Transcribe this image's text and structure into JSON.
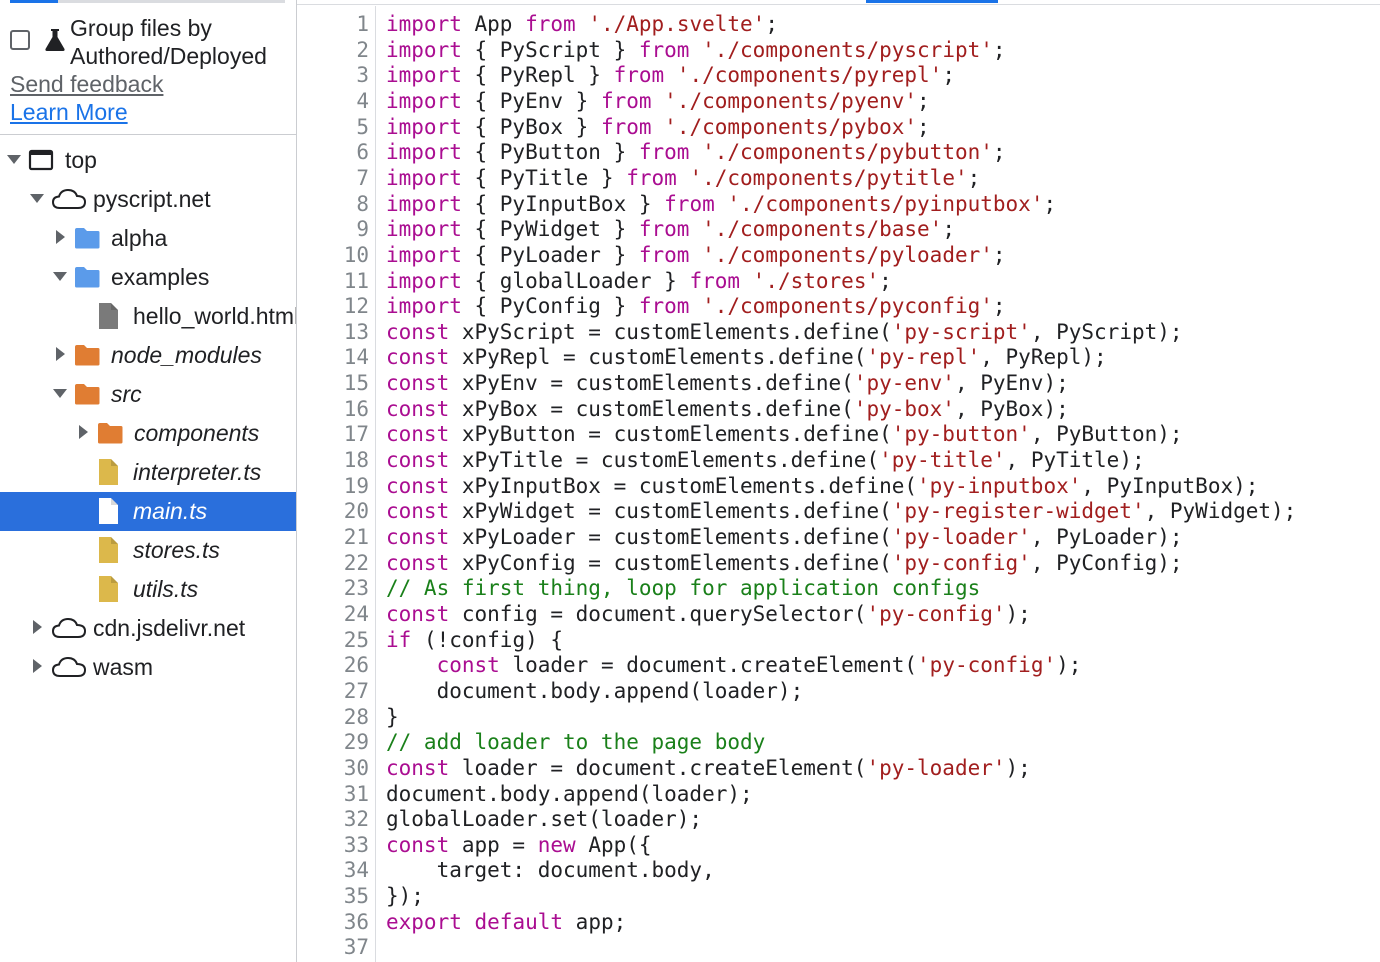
{
  "sidebar": {
    "group_label_line1": "Group files by",
    "group_label_line2": "Authored/Deployed",
    "group_checked": false,
    "feedback_link": "Send feedback",
    "learn_more_link": "Learn More",
    "tree": [
      {
        "label": "top",
        "icon": "frame-icon",
        "expanded": true,
        "italic": false
      },
      {
        "label": "pyscript.net",
        "icon": "cloud-icon",
        "expanded": true,
        "italic": false
      },
      {
        "label": "alpha",
        "icon": "folder-icon",
        "expanded": false,
        "italic": false
      },
      {
        "label": "examples",
        "icon": "folder-icon",
        "expanded": true,
        "italic": false
      },
      {
        "label": "hello_world.html",
        "icon": "file-icon",
        "italic": false
      },
      {
        "label": "node_modules",
        "icon": "folder-icon",
        "expanded": false,
        "italic": true
      },
      {
        "label": "src",
        "icon": "folder-icon",
        "expanded": true,
        "italic": true
      },
      {
        "label": "components",
        "icon": "folder-icon",
        "expanded": false,
        "italic": true
      },
      {
        "label": "interpreter.ts",
        "icon": "file-icon",
        "italic": true
      },
      {
        "label": "main.ts",
        "icon": "file-icon",
        "italic": true,
        "selected": true
      },
      {
        "label": "stores.ts",
        "icon": "file-icon",
        "italic": true
      },
      {
        "label": "utils.ts",
        "icon": "file-icon",
        "italic": true
      },
      {
        "label": "cdn.jsdelivr.net",
        "icon": "cloud-icon",
        "expanded": false,
        "italic": false
      },
      {
        "label": "wasm",
        "icon": "cloud-icon",
        "expanded": false,
        "italic": false
      }
    ]
  },
  "colors": {
    "keyword": "#aa0d91",
    "string": "#a11e1e",
    "comment": "#1a801a",
    "selection": "#2a6fdc",
    "folder_blue": "#5b9bea",
    "folder_orange": "#e07d33",
    "file_gray": "#7a7a7a",
    "file_yellow": "#dcb84b"
  },
  "editor": {
    "lines": [
      "import App from './App.svelte';",
      "import { PyScript } from './components/pyscript';",
      "import { PyRepl } from './components/pyrepl';",
      "import { PyEnv } from './components/pyenv';",
      "import { PyBox } from './components/pybox';",
      "import { PyButton } from './components/pybutton';",
      "import { PyTitle } from './components/pytitle';",
      "import { PyInputBox } from './components/pyinputbox';",
      "import { PyWidget } from './components/base';",
      "import { PyLoader } from './components/pyloader';",
      "import { globalLoader } from './stores';",
      "import { PyConfig } from './components/pyconfig';",
      "const xPyScript = customElements.define('py-script', PyScript);",
      "const xPyRepl = customElements.define('py-repl', PyRepl);",
      "const xPyEnv = customElements.define('py-env', PyEnv);",
      "const xPyBox = customElements.define('py-box', PyBox);",
      "const xPyButton = customElements.define('py-button', PyButton);",
      "const xPyTitle = customElements.define('py-title', PyTitle);",
      "const xPyInputBox = customElements.define('py-inputbox', PyInputBox);",
      "const xPyWidget = customElements.define('py-register-widget', PyWidget);",
      "const xPyLoader = customElements.define('py-loader', PyLoader);",
      "const xPyConfig = customElements.define('py-config', PyConfig);",
      "// As first thing, loop for application configs",
      "const config = document.querySelector('py-config');",
      "if (!config) {",
      "    const loader = document.createElement('py-config');",
      "    document.body.append(loader);",
      "}",
      "// add loader to the page body",
      "const loader = document.createElement('py-loader');",
      "document.body.append(loader);",
      "globalLoader.set(loader);",
      "const app = new App({",
      "    target: document.body,",
      "});",
      "export default app;",
      ""
    ]
  }
}
